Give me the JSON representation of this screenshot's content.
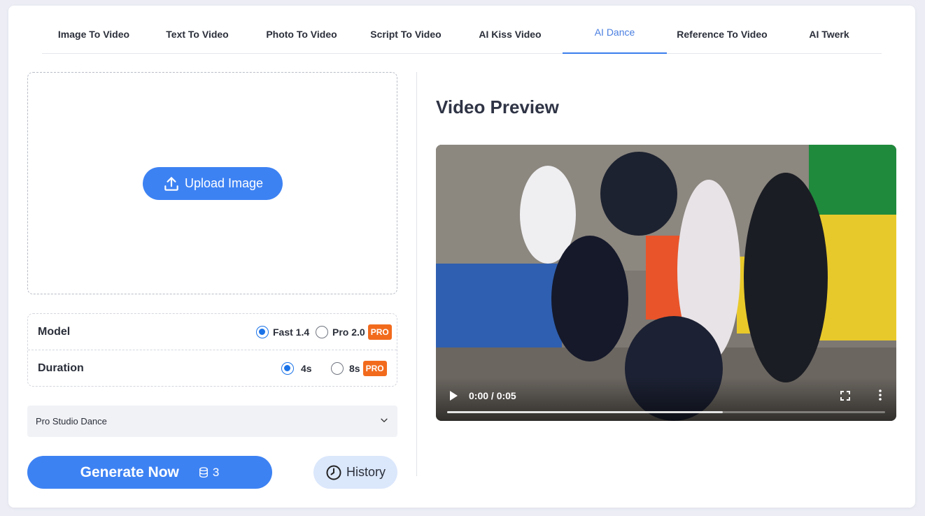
{
  "tabs": [
    {
      "label": "Image To Video",
      "active": false
    },
    {
      "label": "Text To Video",
      "active": false
    },
    {
      "label": "Photo To Video",
      "active": false
    },
    {
      "label": "Script To Video",
      "active": false
    },
    {
      "label": "AI Kiss Video",
      "active": false
    },
    {
      "label": "AI Dance",
      "active": true
    },
    {
      "label": "Reference To Video",
      "active": false
    },
    {
      "label": "AI Twerk",
      "active": false
    }
  ],
  "upload": {
    "label": "Upload Image",
    "icon": "upload-icon"
  },
  "model": {
    "label": "Model",
    "options": [
      {
        "label": "Fast 1.4",
        "checked": true
      },
      {
        "label": "Pro 2.0",
        "checked": false,
        "badge": "PRO"
      }
    ]
  },
  "duration": {
    "label": "Duration",
    "options": [
      {
        "label": "4s",
        "checked": true
      },
      {
        "label": "8s",
        "checked": false,
        "badge": "PRO"
      }
    ]
  },
  "style_select": {
    "value": "Pro Studio Dance",
    "icon": "chevron-down-icon"
  },
  "generate": {
    "label": "Generate Now",
    "credits": "3",
    "icon": "database-icon"
  },
  "history": {
    "label": "History",
    "icon": "clock-icon"
  },
  "preview": {
    "title": "Video Preview",
    "time": "0:00 / 0:05",
    "progress": 0.63
  },
  "colors": {
    "accent": "#3d82f3",
    "active_tab": "#4a7fe0",
    "pro_badge": "#f26b1d",
    "history_bg": "#dbe7fb"
  }
}
